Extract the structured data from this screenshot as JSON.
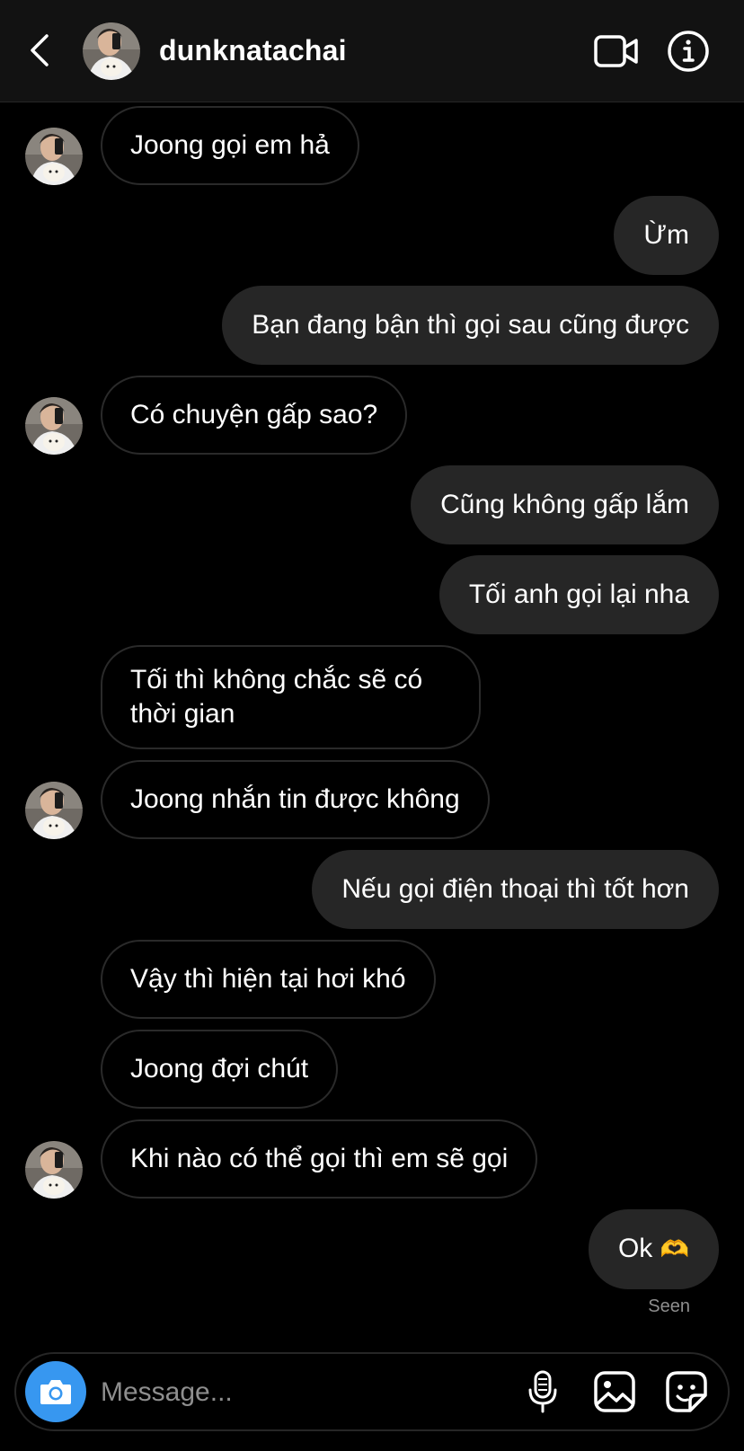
{
  "header": {
    "username": "dunknatachai"
  },
  "messages": [
    {
      "direction": "in",
      "text": "Joong gọi em hả"
    },
    {
      "direction": "out",
      "text": "Ừm"
    },
    {
      "direction": "out",
      "text": "Bạn đang bận thì gọi sau cũng được"
    },
    {
      "direction": "in",
      "text": "Có chuyện gấp sao?"
    },
    {
      "direction": "out",
      "text": "Cũng không gấp lắm"
    },
    {
      "direction": "out",
      "text": "Tối anh gọi lại nha"
    },
    {
      "direction": "in",
      "text": "Tối thì không chắc sẽ có thời gian"
    },
    {
      "direction": "in",
      "text": "Joong nhắn tin được không"
    },
    {
      "direction": "out",
      "text": "Nếu gọi điện thoại thì tốt hơn"
    },
    {
      "direction": "in",
      "text": "Vậy thì hiện tại hơi khó"
    },
    {
      "direction": "in",
      "text": "Joong đợi chút"
    },
    {
      "direction": "in",
      "text": "Khi nào có thể gọi thì em sẽ gọi"
    },
    {
      "direction": "out",
      "text": "Ok",
      "emoji": "🫶"
    }
  ],
  "status": {
    "seen": "Seen"
  },
  "composer": {
    "placeholder": "Message..."
  },
  "icons": {
    "back": "chevron-left-icon",
    "video": "video-camera-icon",
    "info": "info-icon",
    "camera": "camera-icon",
    "mic": "microphone-icon",
    "gallery": "image-icon",
    "sticker": "sticker-icon"
  },
  "colors": {
    "background": "#000000",
    "header": "#121212",
    "outgoing_bubble": "#262626",
    "incoming_border": "#2a2a2a",
    "accent": "#3797f0",
    "muted": "#8e8e8e"
  }
}
